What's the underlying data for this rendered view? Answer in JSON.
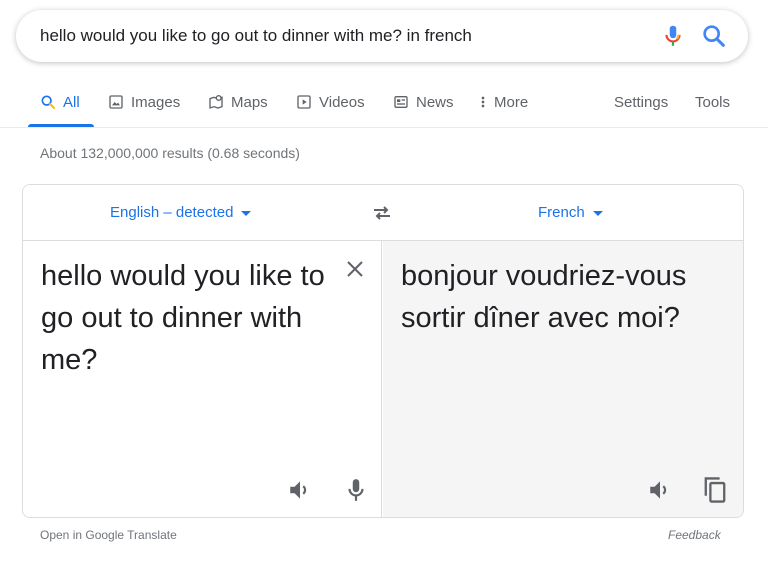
{
  "search": {
    "query": "hello would you like to go out to dinner with me? in french",
    "mic_icon": "mic-icon",
    "search_icon": "search-icon"
  },
  "tabs": [
    {
      "label": "All",
      "icon": "search-icon",
      "active": true
    },
    {
      "label": "Images",
      "icon": "image-icon",
      "active": false
    },
    {
      "label": "Maps",
      "icon": "map-icon",
      "active": false
    },
    {
      "label": "Videos",
      "icon": "video-icon",
      "active": false
    },
    {
      "label": "News",
      "icon": "news-icon",
      "active": false
    },
    {
      "label": "More",
      "icon": "more-vert-icon",
      "active": false
    }
  ],
  "tools": {
    "settings": "Settings",
    "tools": "Tools"
  },
  "stats": "About 132,000,000 results (0.68 seconds)",
  "translate": {
    "source_lang": "English – detected",
    "target_lang": "French",
    "source_text": "hello would you like to go out to dinner with me?",
    "target_text": "bonjour voudriez-vous sortir dîner avec moi?"
  },
  "footer": {
    "open_link": "Open in Google Translate",
    "feedback": "Feedback"
  },
  "colors": {
    "accent": "#1a73e8",
    "text": "#202124",
    "muted": "#70757a",
    "border": "#dadce0",
    "target_bg": "#f5f5f5"
  }
}
